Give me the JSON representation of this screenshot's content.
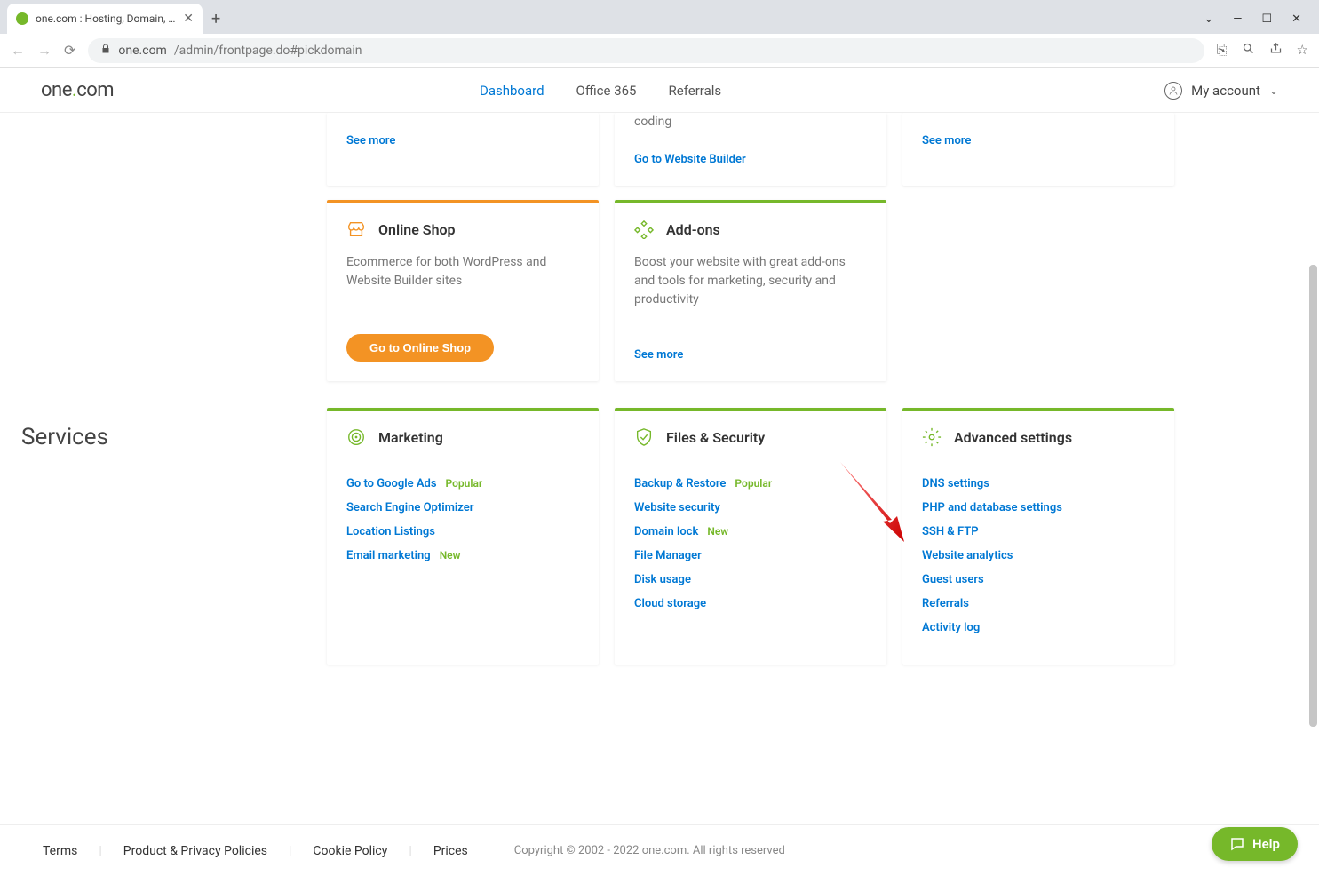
{
  "browser": {
    "tab_title": "one.com : Hosting, Domain, Ema",
    "url_host": "one.com",
    "url_path": "/admin/frontpage.do#pickdomain"
  },
  "header": {
    "logo_text_pre": "one",
    "logo_text_post": "com",
    "nav": [
      {
        "label": "Dashboard",
        "active": true
      },
      {
        "label": "Office 365",
        "active": false
      },
      {
        "label": "Referrals",
        "active": false
      }
    ],
    "account_label": "My account"
  },
  "partial_cards": [
    {
      "desc": "",
      "action_type": "link",
      "action_label": "See more"
    },
    {
      "desc": "coding",
      "action_type": "link",
      "action_label": "Go to Website Builder"
    },
    {
      "desc": "",
      "action_type": "link",
      "action_label": "See more"
    }
  ],
  "feature_cards": [
    {
      "accent": "#f39324",
      "icon": "shop-icon",
      "title": "Online Shop",
      "desc": "Ecommerce for both WordPress and Website Builder sites",
      "action_type": "button",
      "action_label": "Go to Online Shop"
    },
    {
      "accent": "#76b82a",
      "icon": "addons-icon",
      "title": "Add-ons",
      "desc": "Boost your website with great add-ons and tools for marketing, security and productivity",
      "action_type": "link",
      "action_label": "See more"
    }
  ],
  "services_label": "Services",
  "service_cards": [
    {
      "accent": "#76b82a",
      "icon": "target-icon",
      "title": "Marketing",
      "links": [
        {
          "label": "Go to Google Ads",
          "badge": "Popular"
        },
        {
          "label": "Search Engine Optimizer"
        },
        {
          "label": "Location Listings"
        },
        {
          "label": "Email marketing",
          "badge": "New"
        }
      ]
    },
    {
      "accent": "#76b82a",
      "icon": "shield-icon",
      "title": "Files & Security",
      "links": [
        {
          "label": "Backup & Restore",
          "badge": "Popular"
        },
        {
          "label": "Website security"
        },
        {
          "label": "Domain lock",
          "badge": "New"
        },
        {
          "label": "File Manager"
        },
        {
          "label": "Disk usage"
        },
        {
          "label": "Cloud storage"
        }
      ]
    },
    {
      "accent": "#76b82a",
      "icon": "gear-icon",
      "title": "Advanced settings",
      "links": [
        {
          "label": "DNS settings"
        },
        {
          "label": "PHP and database settings"
        },
        {
          "label": "SSH & FTP"
        },
        {
          "label": "Website analytics"
        },
        {
          "label": "Guest users"
        },
        {
          "label": "Referrals"
        },
        {
          "label": "Activity log"
        }
      ]
    }
  ],
  "footer": {
    "links": [
      "Terms",
      "Product & Privacy Policies",
      "Cookie Policy",
      "Prices"
    ],
    "copyright": "Copyright © 2002 - 2022 one.com. All rights reserved"
  },
  "help_label": "Help"
}
